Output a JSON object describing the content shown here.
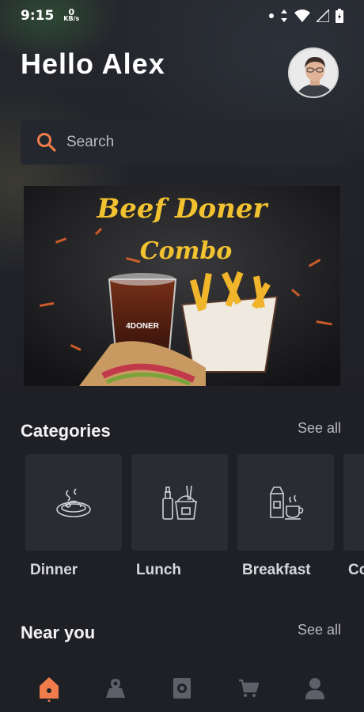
{
  "status_bar": {
    "time": "9:15",
    "net_speed": "0",
    "net_unit": "KB/s"
  },
  "header": {
    "greeting": "Hello Alex"
  },
  "search": {
    "placeholder": "Search"
  },
  "banner": {
    "headline": "Beef Doner",
    "subline": "Combo",
    "cup_brand": "4DONER"
  },
  "categories": {
    "title": "Categories",
    "see_all": "See all",
    "items": [
      {
        "label": "Dinner",
        "icon": "dinner-plate-icon"
      },
      {
        "label": "Lunch",
        "icon": "lunch-box-icon"
      },
      {
        "label": "Breakfast",
        "icon": "breakfast-icon"
      },
      {
        "label": "Co",
        "icon": "category-icon"
      }
    ]
  },
  "near_you": {
    "title": "Near you",
    "see_all": "See all"
  },
  "tabbar": {
    "items": [
      {
        "name": "home-icon",
        "active": true
      },
      {
        "name": "map-icon",
        "active": false
      },
      {
        "name": "menu-book-icon",
        "active": false
      },
      {
        "name": "cart-icon",
        "active": false
      },
      {
        "name": "profile-icon",
        "active": false
      }
    ]
  },
  "colors": {
    "accent": "#f07c4b",
    "background": "#1f2026",
    "tile": "#2a2c33",
    "banner_text": "#f2c230"
  }
}
